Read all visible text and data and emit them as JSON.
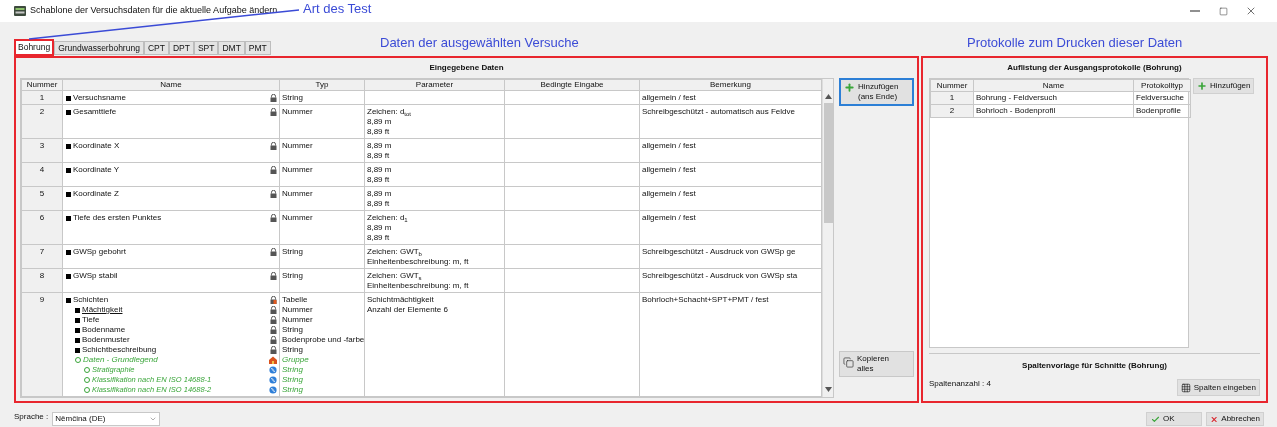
{
  "window": {
    "title": "Schablone der Versuchsdaten für die aktuelle Aufgabe ändern"
  },
  "annotations": [
    {
      "kind": "tabs",
      "text": "Art des Test"
    },
    {
      "kind": "left",
      "text": "Daten der ausgewählten Versuche"
    },
    {
      "kind": "right",
      "text": "Protokolle zum Drucken dieser Daten"
    }
  ],
  "tabs": [
    {
      "label": "Bohrung",
      "selected": true
    },
    {
      "label": "Grundwasserbohrung",
      "selected": false
    },
    {
      "label": "CPT",
      "selected": false
    },
    {
      "label": "DPT",
      "selected": false
    },
    {
      "label": "SPT",
      "selected": false
    },
    {
      "label": "DMT",
      "selected": false
    },
    {
      "label": "PMT",
      "selected": false
    }
  ],
  "data_panel": {
    "title": "Eingegebene Daten",
    "columns": [
      "Nummer",
      "Name",
      "Typ",
      "Parameter",
      "Bedingte Eingabe",
      "Bemerkung"
    ],
    "rows": [
      {
        "number": "1",
        "entries": [
          {
            "name": "Versuchsname",
            "type": "String",
            "kind": "fixed",
            "underlined": false
          }
        ],
        "remark": "allgemein / fest"
      },
      {
        "number": "2",
        "entries": [
          {
            "name": "Gesamttiefe",
            "type": "Nummer",
            "kind": "fixed",
            "underlined": false
          }
        ],
        "parameter": [
          "Zeichen: d$_{tot}$",
          "8,89 m",
          "8,89 ft"
        ],
        "remark": "Schreibgeschützt - automatisch aus Feldve"
      },
      {
        "number": "3",
        "entries": [
          {
            "name": "Koordinate X",
            "type": "Nummer",
            "kind": "fixed",
            "underlined": false
          }
        ],
        "parameter": [
          "8,89 m",
          "8,89 ft"
        ],
        "remark": "allgemein / fest"
      },
      {
        "number": "4",
        "entries": [
          {
            "name": "Koordinate Y",
            "type": "Nummer",
            "kind": "fixed",
            "underlined": false
          }
        ],
        "parameter": [
          "8,89 m",
          "8,89 ft"
        ],
        "remark": "allgemein / fest"
      },
      {
        "number": "5",
        "entries": [
          {
            "name": "Koordinate Z",
            "type": "Nummer",
            "kind": "fixed",
            "underlined": false
          }
        ],
        "parameter": [
          "8,89 m",
          "8,89 ft"
        ],
        "remark": "allgemein / fest"
      },
      {
        "number": "6",
        "entries": [
          {
            "name": "Tiefe des ersten Punktes",
            "type": "Nummer",
            "kind": "fixed",
            "underlined": false
          }
        ],
        "parameter": [
          "Zeichen: d$_{1}$",
          "8,89 m",
          "8,89 ft"
        ],
        "remark": "allgemein / fest"
      },
      {
        "number": "7",
        "entries": [
          {
            "name": "GWSp gebohrt",
            "type": "String",
            "kind": "fixed",
            "underlined": false
          }
        ],
        "parameter": [
          "Zeichen: GWT$_{b}$",
          "Einheitenbeschreibung: m, ft"
        ],
        "remark": "Schreibgeschützt - Ausdruck von GWSp ge"
      },
      {
        "number": "8",
        "entries": [
          {
            "name": "GWSp stabil",
            "type": "String",
            "kind": "fixed",
            "underlined": false
          }
        ],
        "parameter": [
          "Zeichen: GWT$_{s}$",
          "Einheitenbeschreibung: m, ft"
        ],
        "remark": "Schreibgeschützt - Ausdruck von GWSp sta"
      },
      {
        "number": "9",
        "entries": [
          {
            "name": "Schichten",
            "type": "Tabelle",
            "kind": "table",
            "underlined": false,
            "children": [
              {
                "name": "Mächtigkeit",
                "type": "Nummer",
                "kind": "fixed",
                "underlined": true
              },
              {
                "name": "Tiefe",
                "type": "Nummer",
                "kind": "fixed",
                "underlined": false
              },
              {
                "name": "Bodenname",
                "type": "String",
                "kind": "fixed",
                "underlined": false
              },
              {
                "name": "Bodenmuster",
                "type": "Bodenprobe und -farbe",
                "kind": "fixed",
                "underlined": false
              },
              {
                "name": "Schichtbeschreibung",
                "type": "String",
                "kind": "fixed",
                "underlined": false
              },
              {
                "name": "Daten - Grundlegend",
                "type": "Gruppe",
                "kind": "group",
                "underlined": false,
                "children": [
                  {
                    "name": "Stratigraphie",
                    "type": "String",
                    "kind": "optional",
                    "underlined": false
                  },
                  {
                    "name": "Klassifikation nach EN ISO 14688-1",
                    "type": "String",
                    "kind": "optional",
                    "underlined": false
                  },
                  {
                    "name": "Klassifikation nach EN ISO 14688-2",
                    "type": "String",
                    "kind": "optional",
                    "underlined": false
                  }
                ]
              }
            ]
          }
        ],
        "parameter": [
          "Schichtmächtigkeit",
          "Anzahl der Elemente 6"
        ],
        "remark": "Bohrloch+Schacht+SPT+PMT / fest"
      }
    ],
    "buttons": [
      {
        "kind": "add",
        "label": "Hinzufügen (ans Ende)",
        "focused": true
      },
      {
        "kind": "copy",
        "label": "Kopieren alles",
        "focused": false
      }
    ]
  },
  "protocol_panel": {
    "title": "Auflistung der Ausgangsprotokolle (Bohrung)",
    "columns": [
      "Nummer",
      "Name",
      "Protokolltyp"
    ],
    "rows": [
      {
        "number": "1",
        "name": "Bohrung - Feldversuch",
        "type": "Feldversuche"
      },
      {
        "number": "2",
        "name": "Bohrloch - Bodenprofil",
        "type": "Bodenprofile"
      }
    ],
    "add_button": "Hinzufügen",
    "columns_title": "Spaltenvorlage für Schnitte (Bohrung)",
    "column_count": "Spaltenanzahl : 4",
    "columns_button": "Spalten eingeben"
  },
  "footer": {
    "language_label": "Sprache :",
    "language": "Němčina (DE)",
    "ok": "OK",
    "cancel": "Abbrechen"
  }
}
